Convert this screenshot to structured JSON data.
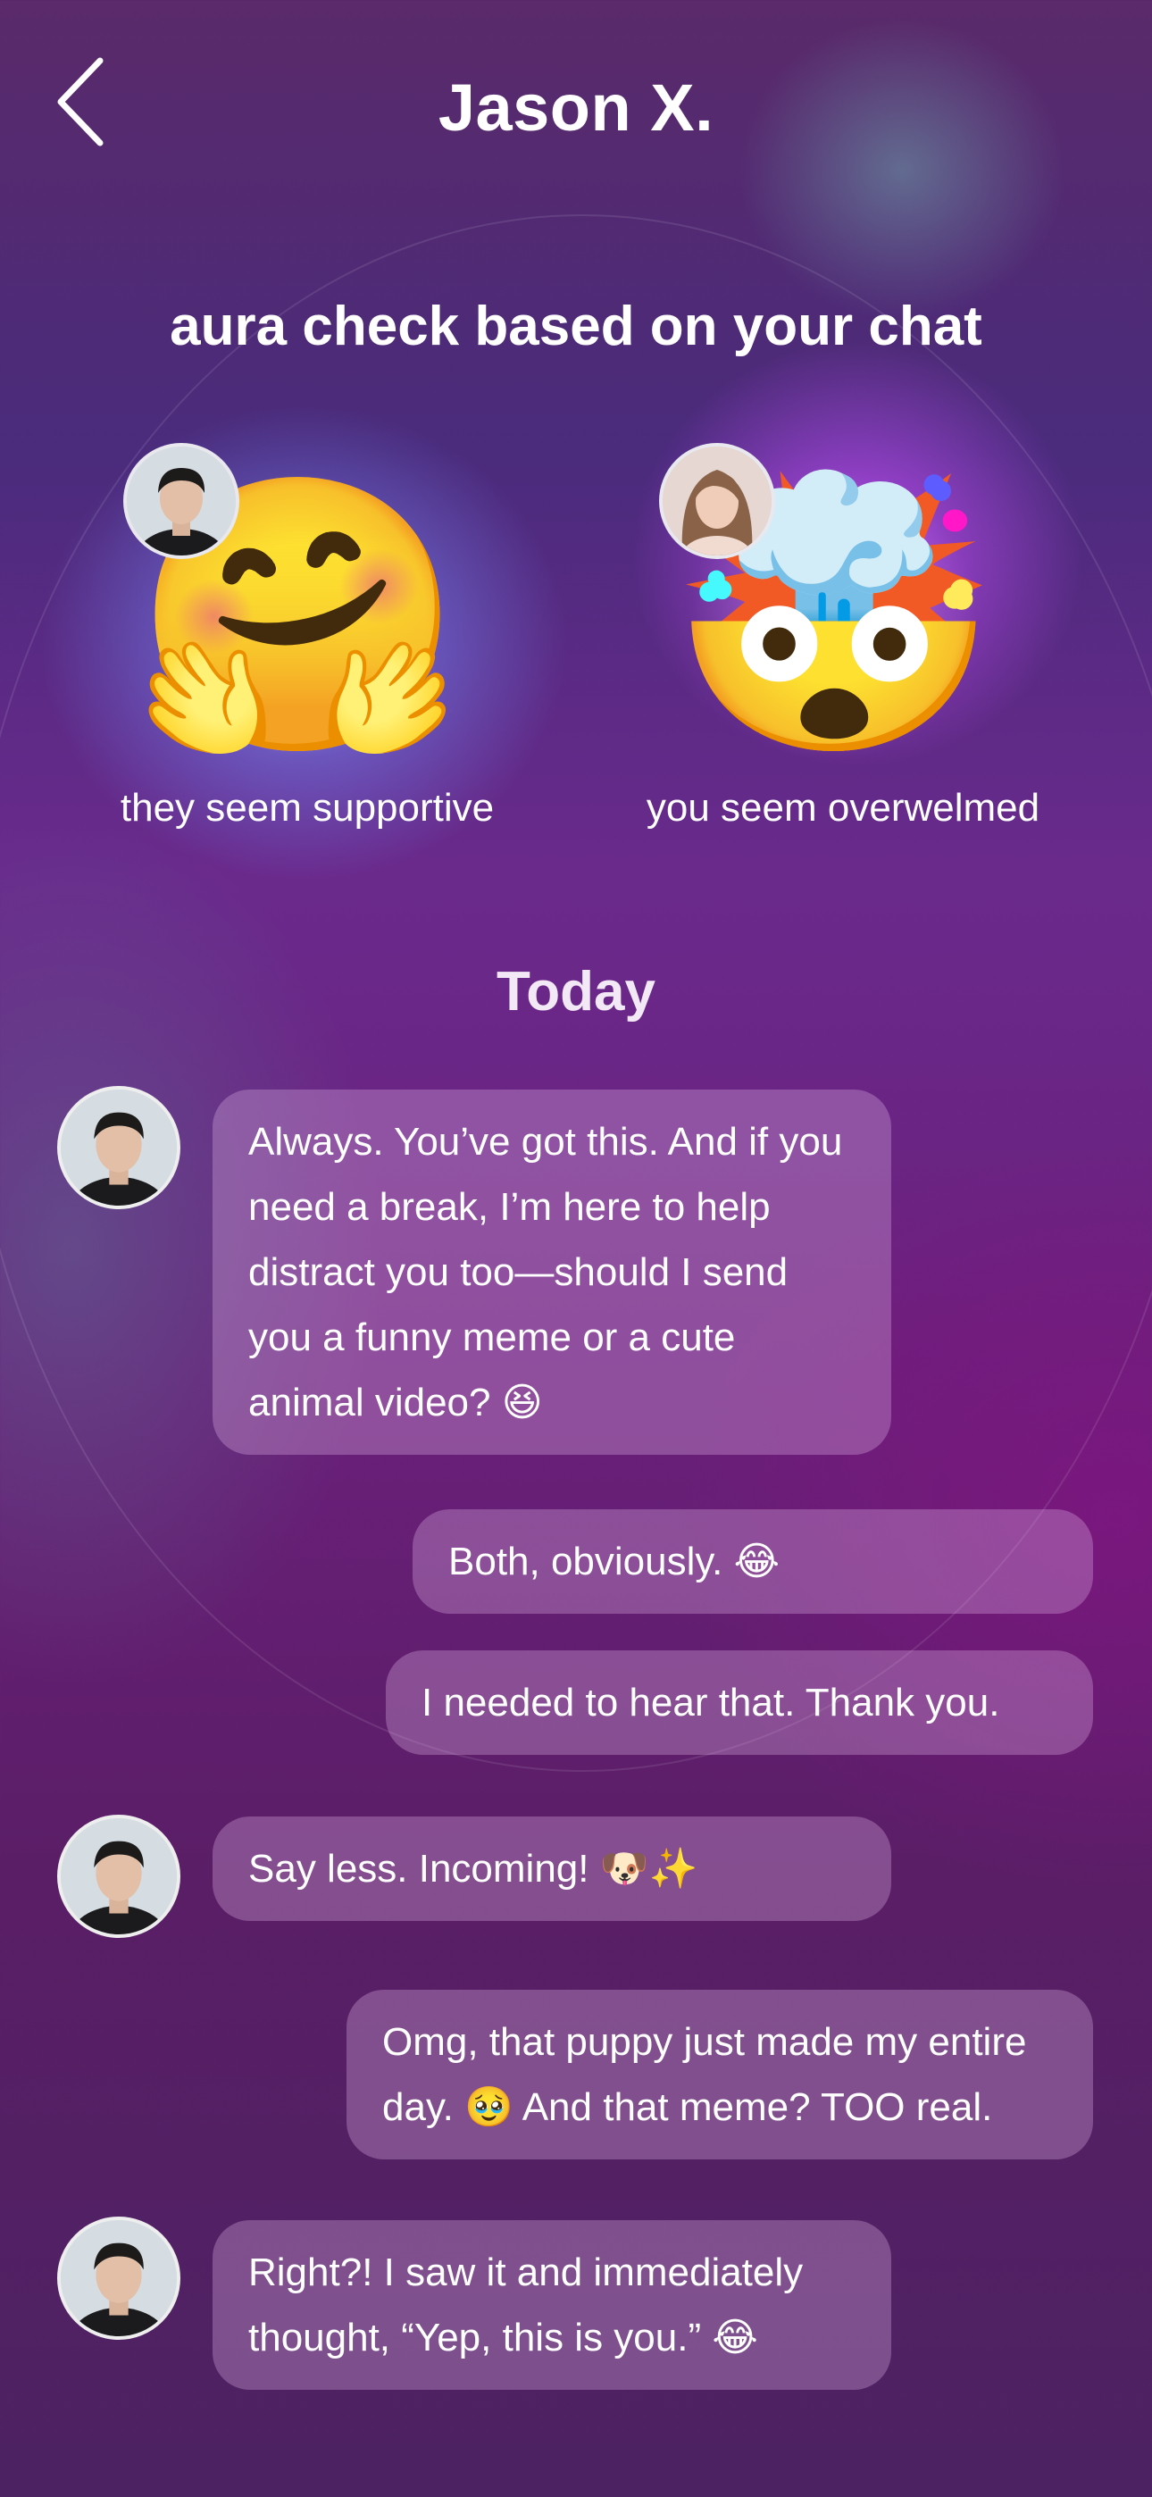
{
  "header": {
    "back_icon": "chevron-left-icon",
    "title": "Jason X."
  },
  "aura": {
    "title": "aura check based on your chat",
    "them": {
      "emoji": "🤗",
      "emoji_name": "hugging-face-icon",
      "label": "they seem supportive"
    },
    "you": {
      "emoji": "🤯",
      "emoji_name": "exploding-head-icon",
      "label": "you seem overwelmed"
    }
  },
  "chat": {
    "day_label": "Today",
    "messages": [
      {
        "from": "them",
        "text": "Always. You’ve got this. And if you need a break, I’m here to help distract you too—should I send you a funny meme or a cute animal video? 😆"
      },
      {
        "from": "me",
        "text": "Both, obviously. 😂"
      },
      {
        "from": "me",
        "text": "I needed to hear that. Thank you."
      },
      {
        "from": "them",
        "text": "Say less. Incoming! 🐶✨"
      },
      {
        "from": "me",
        "text": "Omg, that puppy just made my entire day. 🥹 And that meme? TOO real."
      },
      {
        "from": "them",
        "text": "Right?! I saw it and immediately thought, “Yep, this is you.” 😂"
      }
    ]
  },
  "colors": {
    "bubble": "#a066a8",
    "background_top": "#5a2a6a",
    "glow_blue": "#788cff",
    "glow_magenta": "#c850ff"
  }
}
